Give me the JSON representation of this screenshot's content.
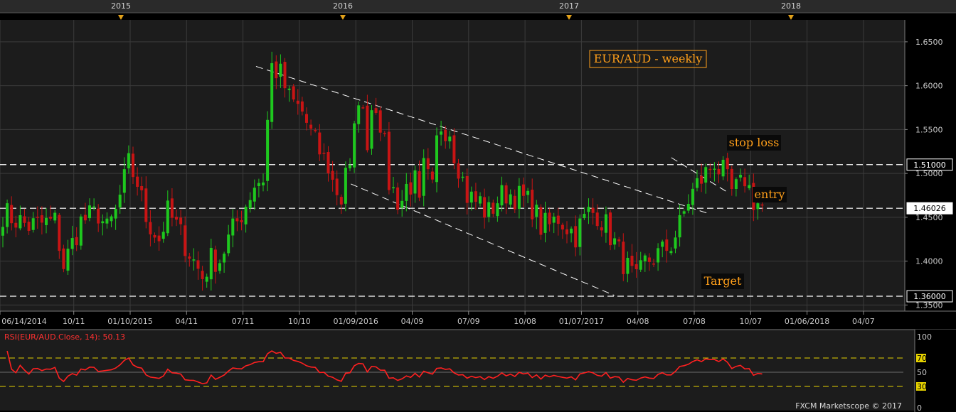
{
  "chart_data": {
    "type": "candlestick",
    "title": "EUR/AUD - weekly",
    "years": [
      "2015",
      "2016",
      "2017",
      "2018"
    ],
    "x_ticks": [
      "06/14/2014",
      "10/11",
      "01/10/2015",
      "04/11",
      "07/11",
      "10/10",
      "01/09/2016",
      "04/09",
      "07/09",
      "10/08",
      "01/07/2017",
      "04/08",
      "07/08",
      "10/07",
      "01/06/2018",
      "04/07"
    ],
    "y_ticks": [
      "1.6500",
      "1.6000",
      "1.5500",
      "1.5000",
      "1.4500",
      "1.4000",
      "1.3500"
    ],
    "ylim": [
      1.343,
      1.675
    ],
    "levels": [
      {
        "value": 1.51,
        "label": "1.51000"
      },
      {
        "value": 1.46026,
        "label": "1.46026",
        "current": true
      },
      {
        "value": 1.36,
        "label": "1.36000"
      }
    ],
    "annotations": [
      {
        "text": "stop loss",
        "value": 1.51
      },
      {
        "text": "entry",
        "value": 1.46
      },
      {
        "text": "Target",
        "value": 1.36
      }
    ],
    "trendlines": [
      {
        "name": "channel-upper",
        "from": [
          "2015-08",
          1.622
        ],
        "to": [
          "2017-08",
          1.454
        ]
      },
      {
        "name": "channel-lower",
        "from": [
          "2016-01",
          1.488
        ],
        "to": [
          "2017-03",
          1.361
        ]
      },
      {
        "name": "flag-upper",
        "from": [
          "2017-06",
          1.518
        ],
        "to": [
          "2017-09",
          1.478
        ]
      }
    ],
    "indicator": {
      "label": "RSI(EUR/AUD.Close, 14): 50.13",
      "ylim": [
        0,
        100
      ],
      "y_ticks": [
        "100",
        "70",
        "50",
        "30",
        "0"
      ],
      "levels": [
        70,
        50,
        30
      ]
    },
    "footer": "FXCM Marketscope © 2017",
    "colors": {
      "up": "#1ec81e",
      "down": "#c81414",
      "rsi": "#ff2020",
      "annotation": "#ff9f1a",
      "level_line": "#ffffff",
      "rsi_guide": "#e6d200",
      "background": "#000000",
      "panel": "#1c1c1c"
    }
  }
}
